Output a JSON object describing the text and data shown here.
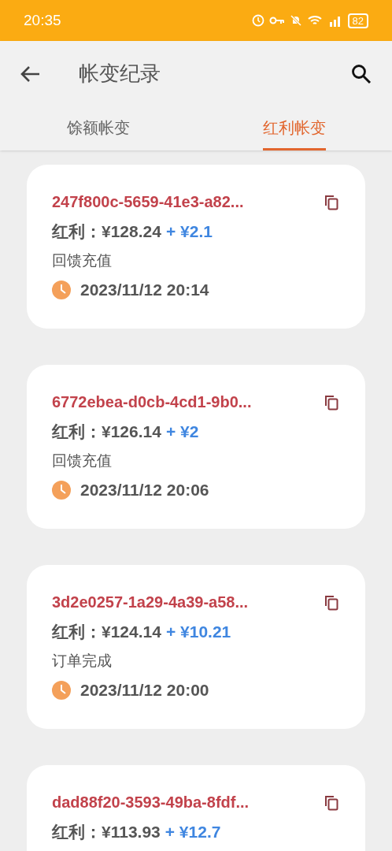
{
  "status_bar": {
    "time": "20:35",
    "battery": "82"
  },
  "header": {
    "title": "帐变纪录"
  },
  "tabs": [
    {
      "label": "馀额帐变",
      "selected": false
    },
    {
      "label": "红利帐变",
      "selected": true
    }
  ],
  "records": [
    {
      "id": "247f800c-5659-41e3-a82...",
      "label": "红利：",
      "balance": "¥128.24",
      "change": "+ ¥2.1",
      "type": "回馈充值",
      "time": "2023/11/12 20:14"
    },
    {
      "id": "6772ebea-d0cb-4cd1-9b0...",
      "label": "红利：",
      "balance": "¥126.14",
      "change": "+ ¥2",
      "type": "回馈充值",
      "time": "2023/11/12 20:06"
    },
    {
      "id": "3d2e0257-1a29-4a39-a58...",
      "label": "红利：",
      "balance": "¥124.14",
      "change": "+ ¥10.21",
      "type": "订单完成",
      "time": "2023/11/12 20:00"
    },
    {
      "id": "dad88f20-3593-49ba-8fdf...",
      "label": "红利：",
      "balance": "¥113.93",
      "change": "+ ¥12.7"
    }
  ]
}
